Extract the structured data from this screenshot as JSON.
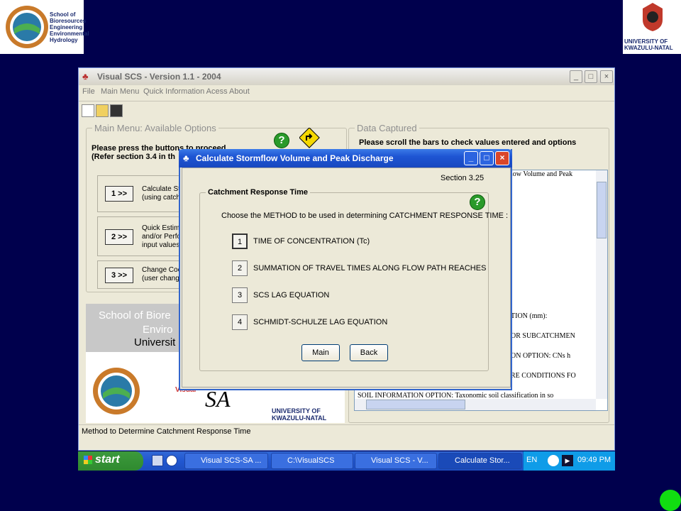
{
  "logos": {
    "left_text": [
      "School of",
      "Bioresources",
      "Engineering",
      "Environmental",
      "Hydrology"
    ],
    "right_text": [
      "UNIVERSITY OF",
      "KWAZULU-NATAL"
    ]
  },
  "main_window": {
    "title": "Visual SCS - Version 1.1 - 2004",
    "menu": [
      "File",
      "Main Menu",
      "Quick Information Acess",
      "About"
    ],
    "main_menu_legend": "Main Menu: Available Options",
    "instructions_line1": "Please press the buttons to proceed",
    "instructions_line2": "(Refer section 3.4 in th",
    "options": [
      {
        "button": "1 >>",
        "text": [
          "Calculate Stor",
          "(using catchm"
        ]
      },
      {
        "button": "2 >>",
        "text": [
          "Quick Estimate",
          "and/or Perform",
          "input values)"
        ]
      },
      {
        "button": "3 >>",
        "text": [
          "Change Coeffi",
          "(user changea"
        ]
      }
    ],
    "banner_lines": [
      "School of Biore",
      "Enviro",
      "Universit"
    ],
    "banner_bottom": [
      "Visual",
      "UNIVERSITY OF",
      "KWAZULU-NATAL"
    ],
    "data_legend": "Data Captured",
    "data_instructions": "Please scroll the bars to check values entered and options",
    "data_lines": [
      "low Volume and Peak",
      "TION (mm):",
      "OR SUBCATCHMEN",
      "ON OPTION:   CNs h",
      "RE CONDITIONS FO",
      "SOIL INFORMATION OPTION:   Taxonomic soil classification in so"
    ],
    "status": "Method to Determine Catchment Response Time"
  },
  "dialog": {
    "title": "Calculate Stormflow Volume and Peak Discharge",
    "section": "Section 3.25",
    "group_legend": "Catchment Response Time",
    "prompt": "Choose the METHOD to be used in determining CATCHMENT RESPONSE TIME :",
    "methods": [
      {
        "num": "1",
        "label": "TIME OF CONCENTRATION (Tc)"
      },
      {
        "num": "2",
        "label": "SUMMATION OF TRAVEL TIMES ALONG FLOW PATH REACHES"
      },
      {
        "num": "3",
        "label": "SCS LAG EQUATION"
      },
      {
        "num": "4",
        "label": "SCHMIDT-SCHULZE LAG EQUATION"
      }
    ],
    "main_button": "Main",
    "back_button": "Back"
  },
  "taskbar": {
    "start": "start",
    "tasks": [
      "Visual SCS-SA ...",
      "C:\\VisualSCS",
      "Visual SCS - V...",
      "Calculate Stor..."
    ],
    "lang": "EN",
    "clock": "09:49 PM"
  },
  "help_icon": "?"
}
